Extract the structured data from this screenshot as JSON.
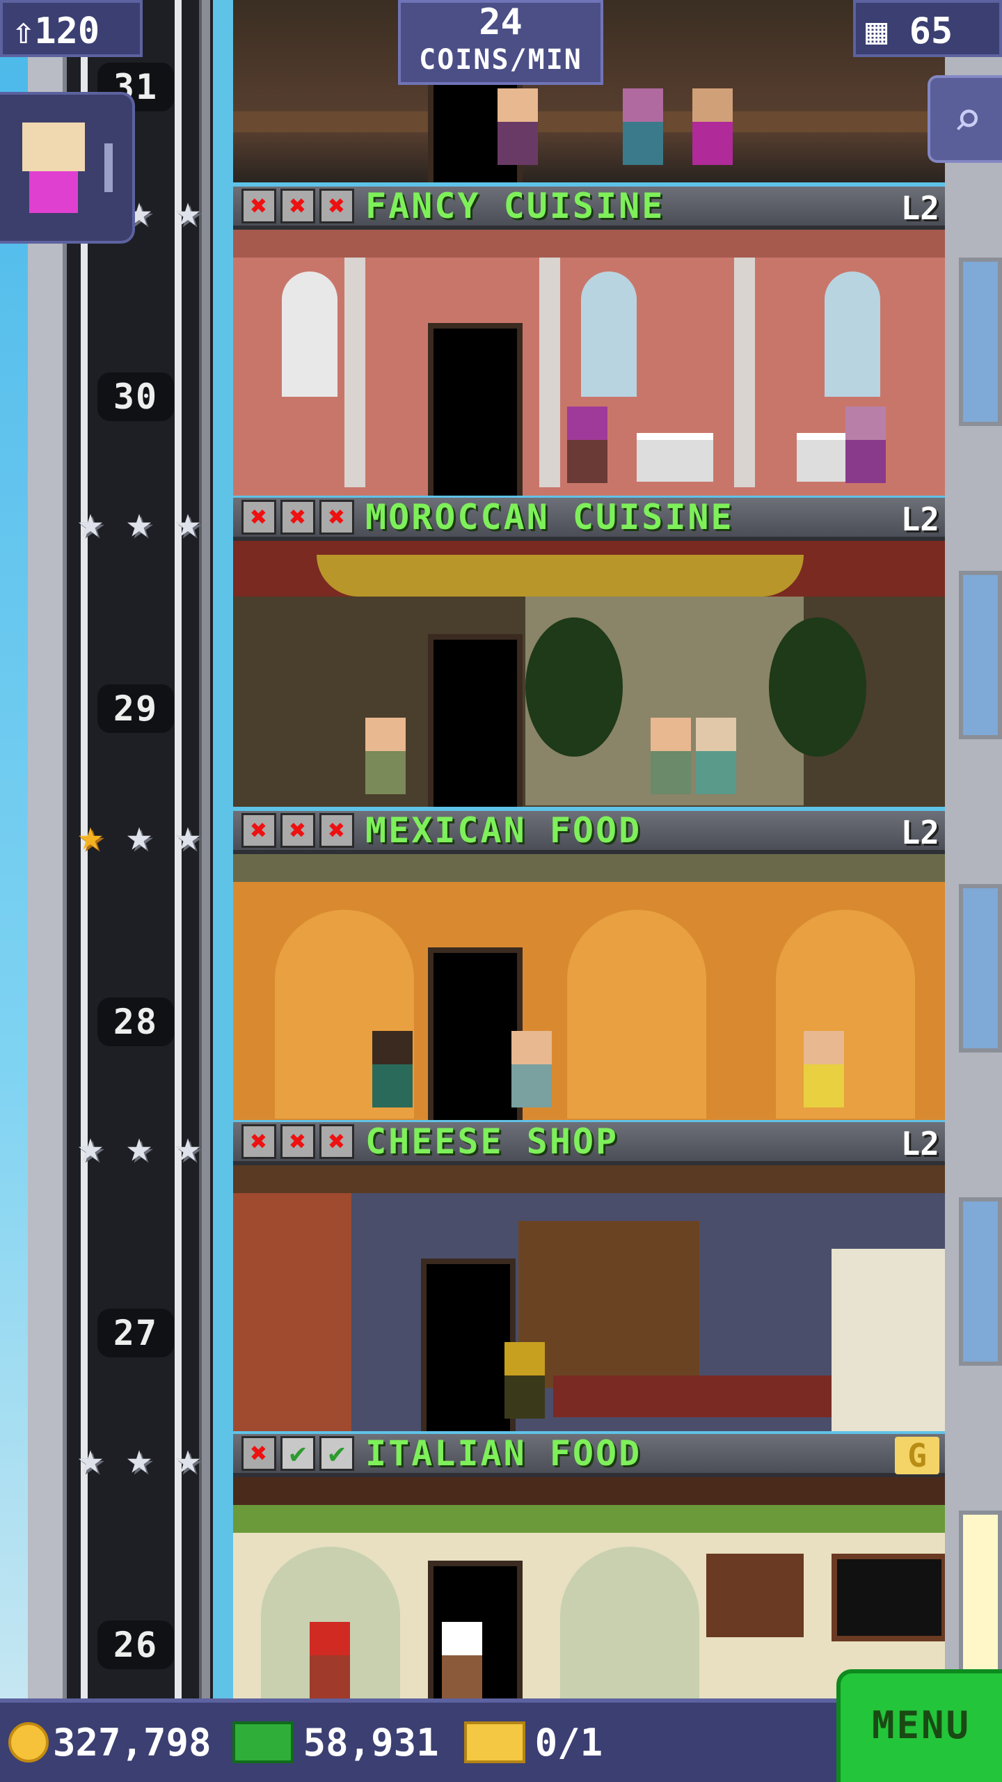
{
  "hud": {
    "population": "120",
    "coins_per_min_value": "24",
    "coins_per_min_label": "COINS/MIN",
    "floors_count": "65",
    "coins": "327,798",
    "bux": "58,931",
    "tickets": "0/1",
    "menu_label": "MENU"
  },
  "colors": {
    "accent_green": "#7ef05a",
    "hud_bg": "#3b3f72",
    "menu_green": "#23c53a"
  },
  "floor_numbers": [
    "31",
    "30",
    "29",
    "28",
    "27",
    "26"
  ],
  "floors": [
    {
      "name": "FANCY CUISINE",
      "level": "L2",
      "marks": [
        "x",
        "x",
        "x"
      ],
      "stars": [
        "silver",
        "silver",
        "silver"
      ]
    },
    {
      "name": "MOROCCAN CUISINE",
      "level": "L2",
      "marks": [
        "x",
        "x",
        "x"
      ],
      "stars": [
        "silver",
        "silver",
        "silver"
      ]
    },
    {
      "name": "MEXICAN FOOD",
      "level": "L2",
      "marks": [
        "x",
        "x",
        "x"
      ],
      "stars": [
        "gold",
        "silver",
        "silver"
      ]
    },
    {
      "name": "CHEESE SHOP",
      "level": "L2",
      "marks": [
        "x",
        "x",
        "x"
      ],
      "stars": [
        "silver",
        "silver",
        "silver"
      ]
    },
    {
      "name": "ITALIAN FOOD",
      "level": "G",
      "marks": [
        "x",
        "check",
        "check"
      ],
      "stars": [
        "silver",
        "silver",
        "silver"
      ]
    }
  ]
}
